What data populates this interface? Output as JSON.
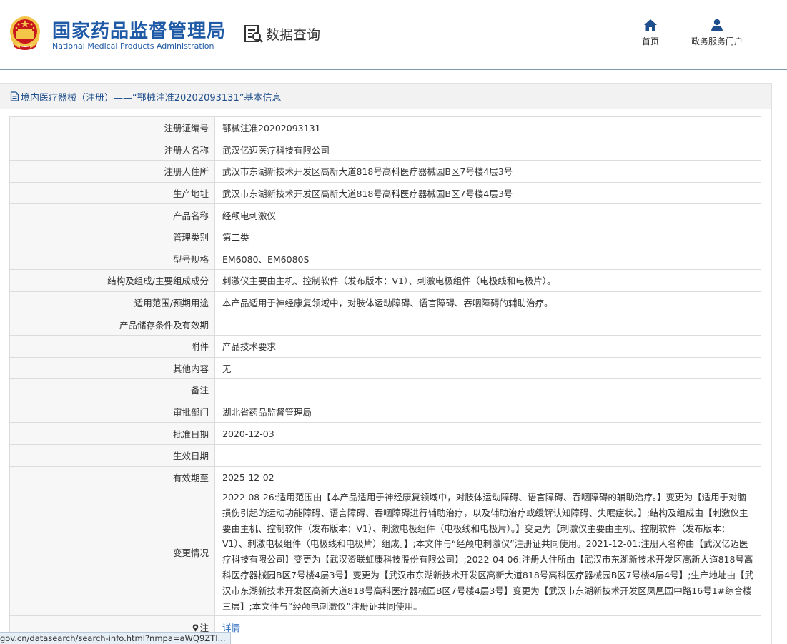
{
  "header": {
    "org_name_cn": "国家药品监督管理局",
    "org_name_en": "National Medical Products Administration",
    "section_title": "数据查询",
    "nav": [
      {
        "label": "首页",
        "icon": "home-icon"
      },
      {
        "label": "政务服务门户",
        "icon": "user-icon"
      }
    ]
  },
  "panel": {
    "title": "境内医疗器械（注册）——“鄂械注准20202093131”基本信息"
  },
  "rows": [
    {
      "key": "注册证编号",
      "value": "鄂械注准20202093131"
    },
    {
      "key": "注册人名称",
      "value": "武汉亿迈医疗科技有限公司"
    },
    {
      "key": "注册人住所",
      "value": "武汉市东湖新技术开发区高新大道818号高科医疗器械园B区7号楼4层3号"
    },
    {
      "key": "生产地址",
      "value": "武汉市东湖新技术开发区高新大道818号高科医疗器械园B区7号楼4层3号"
    },
    {
      "key": "产品名称",
      "value": "经颅电刺激仪"
    },
    {
      "key": "管理类别",
      "value": "第二类"
    },
    {
      "key": "型号规格",
      "value": "EM6080、EM6080S"
    },
    {
      "key": "结构及组成/主要组成成分",
      "value": "刺激仪主要由主机、控制软件（发布版本：V1）、刺激电极组件（电极线和电极片）。"
    },
    {
      "key": "适用范围/预期用途",
      "value": "本产品适用于神经康复领域中，对肢体运动障碍、语言障碍、吞咽障碍的辅助治疗。"
    },
    {
      "key": "产品储存条件及有效期",
      "value": ""
    },
    {
      "key": "附件",
      "value": "产品技术要求"
    },
    {
      "key": "其他内容",
      "value": "无"
    },
    {
      "key": "备注",
      "value": ""
    },
    {
      "key": "审批部门",
      "value": "湖北省药品监督管理局"
    },
    {
      "key": "批准日期",
      "value": "2020-12-03"
    },
    {
      "key": "生效日期",
      "value": ""
    },
    {
      "key": "有效期至",
      "value": "2025-12-02"
    },
    {
      "key": "变更情况",
      "value": "2022-08-26:适用范围由【本产品适用于神经康复领域中，对肢体运动障碍、语言障碍、吞咽障碍的辅助治疗。】变更为【适用于对脑损伤引起的运动功能障碍、语言障碍、吞咽障碍进行辅助治疗，以及辅助治疗或缓解认知障碍、失眠症状。】;结构及组成由【刺激仪主要由主机、控制软件（发布版本：V1）、刺激电极组件（电极线和电极片）。】变更为【刺激仪主要由主机、控制软件（发布版本：V1）、刺激电极组件（电极线和电极片）组成。】;本文件与“经颅电刺激仪”注册证共同使用。2021-12-01:注册人名称由【武汉亿迈医疗科技有限公司】变更为【武汉资联虹康科技股份有限公司】;2022-04-06:注册人住所由【武汉市东湖新技术开发区高新大道818号高科医疗器械园B区7号楼4层3号】变更为【武汉市东湖新技术开发区高新大道818号高科医疗器械园B区7号楼4层4号】;生产地址由【武汉市东湖新技术开发区高新大道818号高科医疗器械园B区7号楼4层3号】变更为【武汉市东湖新技术开发区凤凰园中路16号1#综合楼三层】;本文件与“经颅电刺激仪”注册证共同使用。"
    }
  ],
  "note_row": {
    "key": "注",
    "link": "详情"
  },
  "status_bar": {
    "url": "gov.cn/datasearch/search-info.html?nmpa=aWQ9ZTI..."
  },
  "colors": {
    "brand_blue": "#1f5aa6",
    "title_blue": "#1f4e8c",
    "link_blue": "#2266bb",
    "emblem_red": "#c8161d",
    "emblem_gold": "#f3c64a"
  }
}
